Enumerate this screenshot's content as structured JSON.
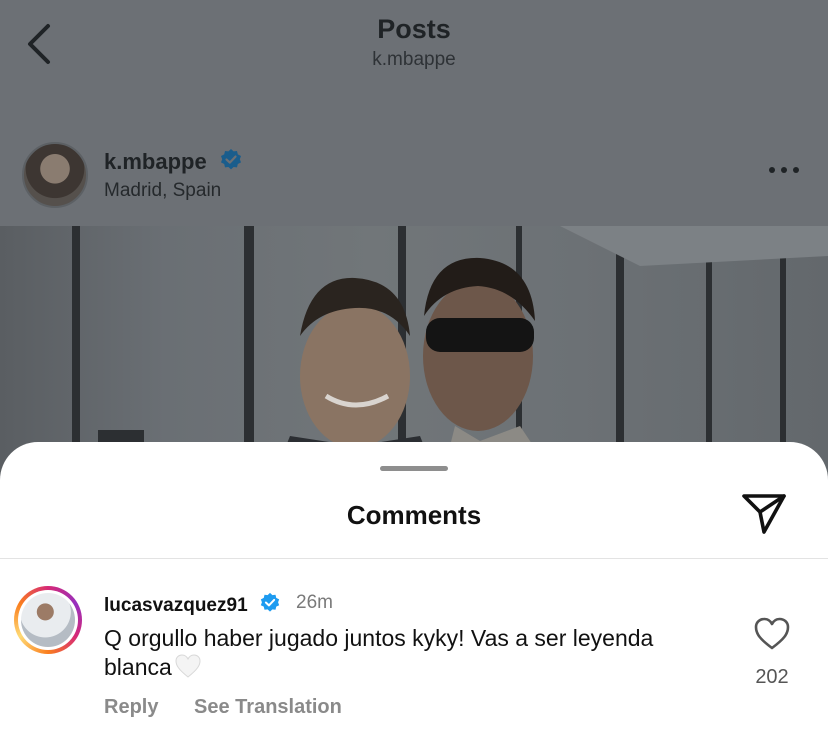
{
  "header": {
    "title": "Posts",
    "subtitle": "k.mbappe"
  },
  "post": {
    "username": "k.mbappe",
    "location": "Madrid, Spain"
  },
  "comments_sheet": {
    "title": "Comments"
  },
  "comment": {
    "username": "lucasvazquez91",
    "time": "26m",
    "text": "Q orgullo haber jugado juntos kyky! Vas a ser leyenda blanca",
    "like_count": "202",
    "reply_label": "Reply",
    "translate_label": "See Translation"
  },
  "colors": {
    "verified": "#1d9bf0",
    "overlay": "#6c7075",
    "sheet": "#ffffff"
  },
  "icons": [
    "back-chevron-icon",
    "verified-badge-icon",
    "more-dots-icon",
    "share-send-icon",
    "heart-outline-icon",
    "white-heart-emoji-icon"
  ]
}
